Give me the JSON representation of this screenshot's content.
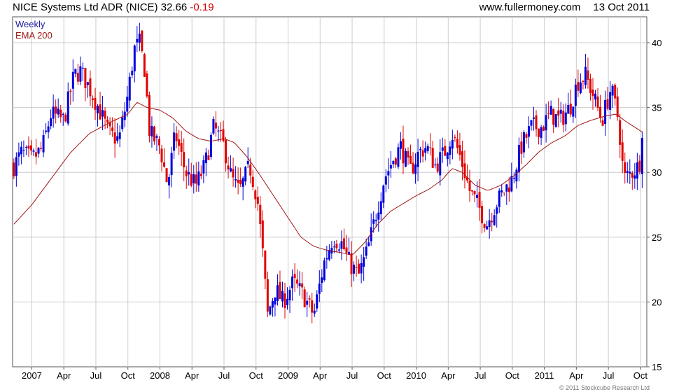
{
  "header": {
    "title": "NICE Systems Ltd ADR (NICE) 32.66",
    "change": "-0.19",
    "site": "www.fullermoney.com",
    "date": "13 Oct 2011"
  },
  "copyright": "© 2011 Stockcube Research Ltd",
  "chart_data": {
    "type": "candlestick",
    "legend": [
      "Weekly",
      "EMA 200"
    ],
    "legend_position": "top-left",
    "colors": {
      "up": "#0000dd",
      "down": "#e00000",
      "ema": "#a01818",
      "grid": "#cccccc",
      "legend_weekly": "#2020a0",
      "legend_ema": "#a01818"
    },
    "y_axis": {
      "side": "right",
      "min": 15,
      "max": 42,
      "ticks": [
        15,
        20,
        25,
        30,
        35,
        40
      ]
    },
    "x_axis": {
      "ticks": [
        {
          "label": "2007",
          "t": 2007.0
        },
        {
          "label": "Apr",
          "t": 2007.25
        },
        {
          "label": "Jul",
          "t": 2007.5
        },
        {
          "label": "Oct",
          "t": 2007.75
        },
        {
          "label": "2008",
          "t": 2008.0
        },
        {
          "label": "Apr",
          "t": 2008.25
        },
        {
          "label": "Jul",
          "t": 2008.5
        },
        {
          "label": "Oct",
          "t": 2008.75
        },
        {
          "label": "2009",
          "t": 2009.0
        },
        {
          "label": "Apr",
          "t": 2009.25
        },
        {
          "label": "Jul",
          "t": 2009.5
        },
        {
          "label": "Oct",
          "t": 2009.75
        },
        {
          "label": "2010",
          "t": 2010.0
        },
        {
          "label": "Apr",
          "t": 2010.25
        },
        {
          "label": "Jul",
          "t": 2010.5
        },
        {
          "label": "Oct",
          "t": 2010.75
        },
        {
          "label": "2011",
          "t": 2011.0
        },
        {
          "label": "Apr",
          "t": 2011.25
        },
        {
          "label": "Jul",
          "t": 2011.5
        },
        {
          "label": "Oct",
          "t": 2011.75
        }
      ],
      "range": [
        2006.85,
        2011.8
      ]
    },
    "weekly_close_anchors": [
      [
        2006.86,
        30.5
      ],
      [
        2006.92,
        31.5
      ],
      [
        2007.0,
        31.0
      ],
      [
        2007.08,
        31.8
      ],
      [
        2007.15,
        34.5
      ],
      [
        2007.25,
        34.0
      ],
      [
        2007.33,
        37.5
      ],
      [
        2007.38,
        37.8
      ],
      [
        2007.45,
        36.5
      ],
      [
        2007.52,
        35.0
      ],
      [
        2007.6,
        33.0
      ],
      [
        2007.68,
        32.5
      ],
      [
        2007.75,
        36.0
      ],
      [
        2007.8,
        39.5
      ],
      [
        2007.84,
        40.0
      ],
      [
        2007.88,
        38.0
      ],
      [
        2007.92,
        33.0
      ],
      [
        2008.0,
        32.0
      ],
      [
        2008.06,
        29.0
      ],
      [
        2008.12,
        33.0
      ],
      [
        2008.2,
        30.0
      ],
      [
        2008.28,
        29.0
      ],
      [
        2008.35,
        30.5
      ],
      [
        2008.42,
        33.5
      ],
      [
        2008.5,
        32.0
      ],
      [
        2008.56,
        29.5
      ],
      [
        2008.62,
        28.5
      ],
      [
        2008.7,
        30.5
      ],
      [
        2008.76,
        28.0
      ],
      [
        2008.8,
        24.0
      ],
      [
        2008.84,
        19.0
      ],
      [
        2008.9,
        21.0
      ],
      [
        2008.96,
        20.0
      ],
      [
        2009.04,
        21.5
      ],
      [
        2009.12,
        20.5
      ],
      [
        2009.2,
        19.0
      ],
      [
        2009.28,
        23.0
      ],
      [
        2009.35,
        25.0
      ],
      [
        2009.42,
        24.5
      ],
      [
        2009.48,
        23.0
      ],
      [
        2009.55,
        22.0
      ],
      [
        2009.62,
        24.0
      ],
      [
        2009.68,
        26.5
      ],
      [
        2009.75,
        29.5
      ],
      [
        2009.82,
        31.0
      ],
      [
        2009.88,
        32.0
      ],
      [
        2009.95,
        30.0
      ],
      [
        2010.02,
        31.5
      ],
      [
        2010.08,
        32.0
      ],
      [
        2010.15,
        30.5
      ],
      [
        2010.22,
        31.5
      ],
      [
        2010.28,
        33.0
      ],
      [
        2010.35,
        31.0
      ],
      [
        2010.42,
        28.5
      ],
      [
        2010.48,
        27.5
      ],
      [
        2010.55,
        26.0
      ],
      [
        2010.62,
        27.5
      ],
      [
        2010.68,
        28.5
      ],
      [
        2010.75,
        29.5
      ],
      [
        2010.82,
        32.0
      ],
      [
        2010.9,
        33.5
      ],
      [
        2010.98,
        33.5
      ],
      [
        2011.05,
        34.5
      ],
      [
        2011.12,
        34.0
      ],
      [
        2011.2,
        35.0
      ],
      [
        2011.26,
        37.0
      ],
      [
        2011.32,
        37.5
      ],
      [
        2011.38,
        36.0
      ],
      [
        2011.45,
        34.0
      ],
      [
        2011.52,
        36.5
      ],
      [
        2011.58,
        34.0
      ],
      [
        2011.62,
        29.5
      ],
      [
        2011.68,
        30.0
      ],
      [
        2011.74,
        30.5
      ],
      [
        2011.77,
        32.66
      ]
    ],
    "ema_anchors": [
      [
        2006.86,
        26.0
      ],
      [
        2007.0,
        27.5
      ],
      [
        2007.15,
        29.5
      ],
      [
        2007.3,
        31.5
      ],
      [
        2007.45,
        33.0
      ],
      [
        2007.6,
        33.8
      ],
      [
        2007.75,
        34.5
      ],
      [
        2007.82,
        35.4
      ],
      [
        2007.9,
        35.0
      ],
      [
        2008.0,
        34.8
      ],
      [
        2008.1,
        34.2
      ],
      [
        2008.2,
        33.2
      ],
      [
        2008.3,
        32.6
      ],
      [
        2008.4,
        32.4
      ],
      [
        2008.5,
        32.6
      ],
      [
        2008.58,
        32.3
      ],
      [
        2008.68,
        31.2
      ],
      [
        2008.78,
        29.8
      ],
      [
        2008.88,
        28.3
      ],
      [
        2009.0,
        26.5
      ],
      [
        2009.1,
        25.0
      ],
      [
        2009.2,
        24.3
      ],
      [
        2009.3,
        24.0
      ],
      [
        2009.42,
        23.8
      ],
      [
        2009.5,
        23.6
      ],
      [
        2009.6,
        24.6
      ],
      [
        2009.7,
        26.0
      ],
      [
        2009.8,
        27.0
      ],
      [
        2009.9,
        27.6
      ],
      [
        2010.0,
        28.2
      ],
      [
        2010.1,
        28.7
      ],
      [
        2010.2,
        29.4
      ],
      [
        2010.28,
        30.3
      ],
      [
        2010.36,
        30.0
      ],
      [
        2010.46,
        29.0
      ],
      [
        2010.56,
        28.6
      ],
      [
        2010.66,
        29.0
      ],
      [
        2010.76,
        29.7
      ],
      [
        2010.86,
        30.6
      ],
      [
        2010.96,
        31.6
      ],
      [
        2011.06,
        32.3
      ],
      [
        2011.16,
        32.8
      ],
      [
        2011.26,
        33.6
      ],
      [
        2011.36,
        34.0
      ],
      [
        2011.46,
        34.3
      ],
      [
        2011.56,
        34.5
      ],
      [
        2011.64,
        33.9
      ],
      [
        2011.72,
        33.4
      ],
      [
        2011.78,
        33.0
      ]
    ]
  }
}
